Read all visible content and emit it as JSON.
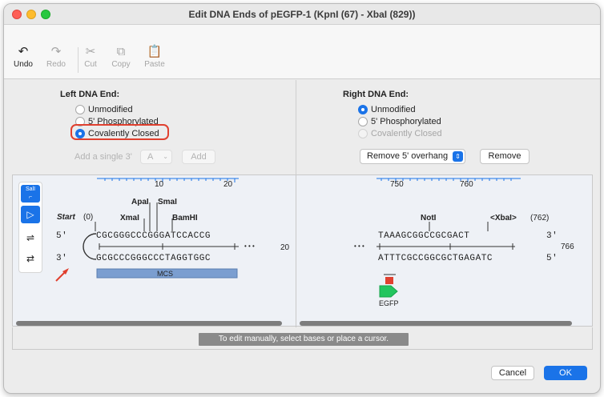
{
  "window": {
    "title": "Edit DNA Ends of pEGFP-1 (KpnI (67) - XbaI (829))"
  },
  "toolbar": {
    "undo": "Undo",
    "redo": "Redo",
    "cut": "Cut",
    "copy": "Copy",
    "paste": "Paste"
  },
  "left_end": {
    "title": "Left DNA End:",
    "options": [
      "Unmodified",
      "5' Phosphorylated",
      "Covalently Closed"
    ],
    "selected": "Covalently Closed",
    "add_label": "Add a single 3'",
    "base_value": "A",
    "add_button": "Add"
  },
  "right_end": {
    "title": "Right DNA End:",
    "options": [
      "Unmodified",
      "5' Phosphorylated",
      "Covalently Closed"
    ],
    "selected": "Unmodified",
    "overhang_select": "Remove 5' overhang",
    "remove_button": "Remove"
  },
  "left_map": {
    "ruler": [
      "10",
      "20"
    ],
    "tool_label": "SalI",
    "enzymes": [
      "ApaI",
      "SmaI",
      "XmaI",
      "BamHI"
    ],
    "start_label": "Start",
    "start_pos": "(0)",
    "top_strand": "CGCGGGCCCGGGATCCACCG",
    "bottom_strand": "GCGCCCGGGCCCTAGGTGGC",
    "five_prime": "5'",
    "three_prime": "3'",
    "ellipsis": "• • •",
    "end_num": "20",
    "feature": "MCS"
  },
  "right_map": {
    "ruler": [
      "750",
      "760"
    ],
    "enzymes": [
      "NotI",
      "<XbaI>"
    ],
    "xbai_pos": "(762)",
    "top_strand": "TAAAGCGGCCGCGACT",
    "bottom_strand": "ATTTCGCCGGCGCTGAGATC",
    "three_prime": "3'",
    "five_prime": "5'",
    "ellipsis": "• • •",
    "end_num": "766",
    "feature": "EGFP"
  },
  "status": {
    "hint": "To edit manually, select bases or place a cursor."
  },
  "buttons": {
    "cancel": "Cancel",
    "ok": "OK"
  },
  "colors": {
    "accent": "#1a73e8",
    "highlight": "#e0402f",
    "mcs": "#7b9ed0",
    "egfp": "#22c55e"
  }
}
